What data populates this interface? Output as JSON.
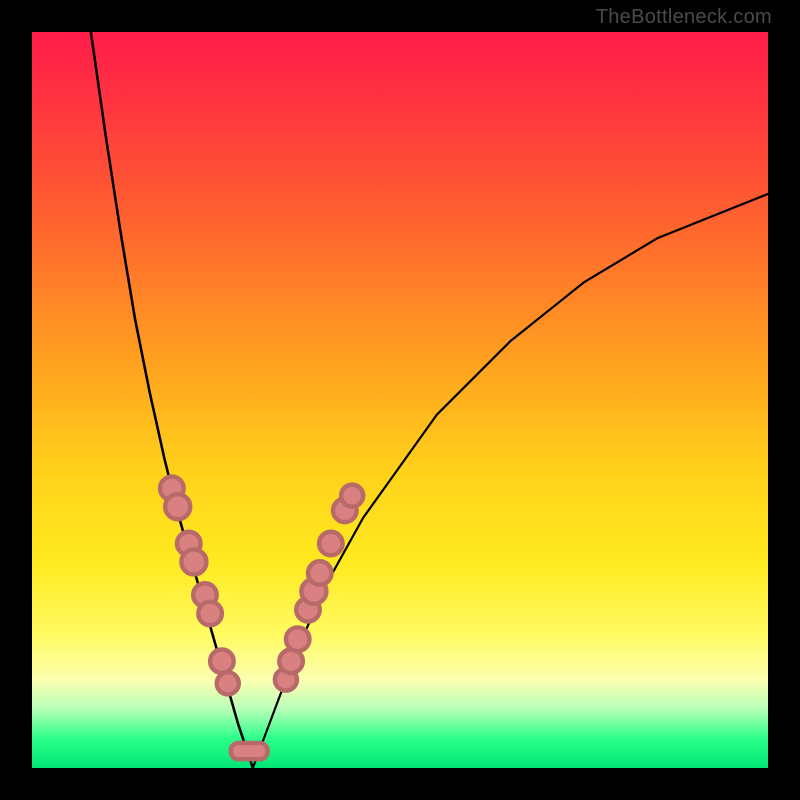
{
  "attribution": "TheBottleneck.com",
  "colors": {
    "frame": "#000000",
    "gradient_top": "#ff1c49",
    "gradient_mid": "#ffd21a",
    "gradient_bottom": "#00e676",
    "curve": "#000000",
    "beads_fill": "#d98080",
    "beads_stroke": "#b86a6a"
  },
  "chart_data": {
    "type": "line",
    "title": "",
    "xlabel": "",
    "ylabel": "",
    "xlim": [
      0,
      100
    ],
    "ylim": [
      0,
      100
    ],
    "grid": false,
    "legend": false,
    "note": "V-shaped bottleneck curve; vertex near x≈30, y≈0. Left branch rises steeply to y≈100 at x≈8; right branch rises with decreasing slope to y≈78 at x=100. Beads cluster on both branches roughly y∈[18,44] plus a short horizontal segment at the vertex.",
    "series": [
      {
        "name": "left_branch",
        "x": [
          8,
          10,
          12,
          14,
          16,
          18,
          20,
          22,
          24,
          26,
          28,
          30
        ],
        "y": [
          100,
          86,
          73,
          61,
          51,
          42,
          34,
          27,
          20,
          13,
          6,
          0
        ]
      },
      {
        "name": "right_branch",
        "x": [
          30,
          33,
          36,
          40,
          45,
          50,
          55,
          60,
          65,
          70,
          75,
          80,
          85,
          90,
          95,
          100
        ],
        "y": [
          0,
          8,
          16,
          25,
          34,
          41,
          48,
          53,
          58,
          62,
          66,
          69,
          72,
          74,
          76,
          78
        ]
      }
    ],
    "beads_left": [
      {
        "x": 19.0,
        "y": 38.0,
        "r": 1.6
      },
      {
        "x": 19.8,
        "y": 35.5,
        "r": 1.7
      },
      {
        "x": 21.3,
        "y": 30.5,
        "r": 1.6
      },
      {
        "x": 22.0,
        "y": 28.0,
        "r": 1.7
      },
      {
        "x": 23.5,
        "y": 23.5,
        "r": 1.6
      },
      {
        "x": 24.2,
        "y": 21.0,
        "r": 1.6
      },
      {
        "x": 25.8,
        "y": 14.5,
        "r": 1.6
      },
      {
        "x": 26.6,
        "y": 11.5,
        "r": 1.5
      }
    ],
    "beads_right": [
      {
        "x": 34.5,
        "y": 12.0,
        "r": 1.5
      },
      {
        "x": 35.2,
        "y": 14.5,
        "r": 1.6
      },
      {
        "x": 36.1,
        "y": 17.5,
        "r": 1.6
      },
      {
        "x": 37.5,
        "y": 21.5,
        "r": 1.6
      },
      {
        "x": 38.3,
        "y": 24.0,
        "r": 1.7
      },
      {
        "x": 39.1,
        "y": 26.5,
        "r": 1.6
      },
      {
        "x": 40.6,
        "y": 30.5,
        "r": 1.6
      },
      {
        "x": 42.5,
        "y": 35.0,
        "r": 1.6
      },
      {
        "x": 43.5,
        "y": 37.0,
        "r": 1.5
      }
    ],
    "vertex_pill": {
      "x0": 27.0,
      "x1": 32.0,
      "y": 1.2,
      "h": 2.2
    }
  }
}
